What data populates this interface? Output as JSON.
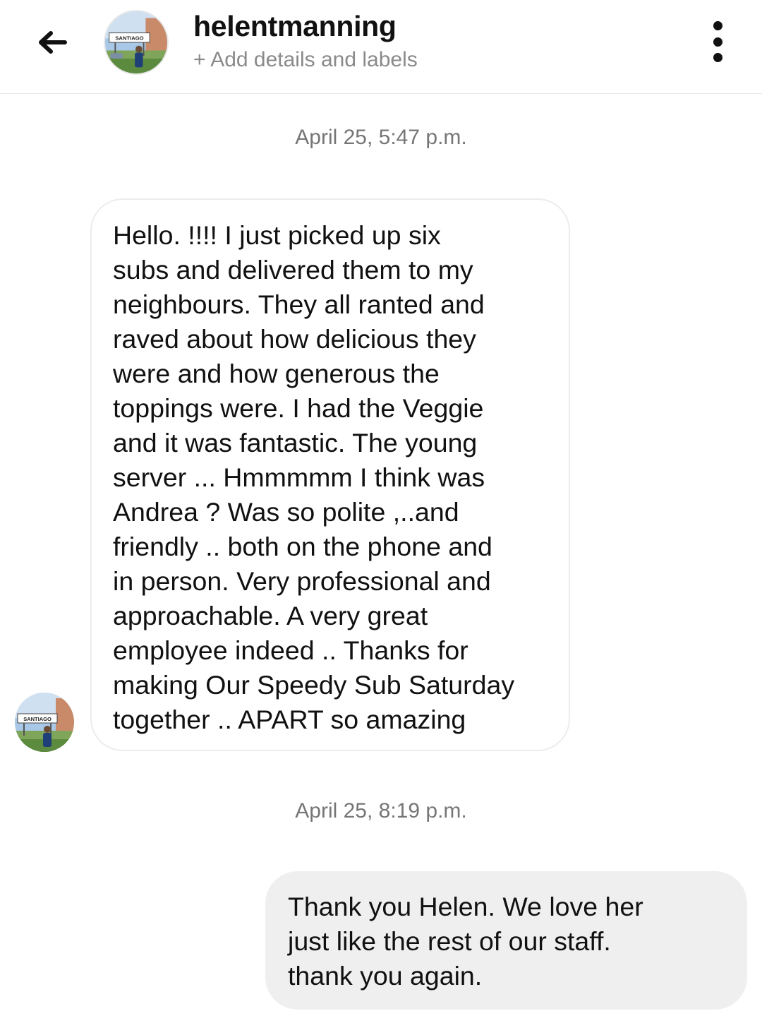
{
  "header": {
    "back_icon": "arrow-left-icon",
    "username": "helentmanning",
    "add_details": "+ Add details and labels",
    "more_icon": "vertical-dots-icon",
    "avatar_sign_text": "SANTIAGO"
  },
  "messages": [
    {
      "timestamp": "April 25, 5:47 p.m.",
      "direction": "incoming",
      "text": "Hello. !!!!  I just picked up six\nsubs and delivered them to my\nneighbours.  They all ranted and\nraved about how delicious they\nwere and how generous the\ntoppings were.  I had the Veggie\nand it was fantastic. The young\nserver ... Hmmmmm I think was\nAndrea ?  Was so polite ,..and\nfriendly .. both on the phone and\nin person.  Very professional and\napproachable. A very great\nemployee indeed ..  Thanks for\nmaking Our Speedy Sub Saturday\ntogether ..   APART so  amazing"
    },
    {
      "timestamp": "April 25, 8:19 p.m.",
      "direction": "outgoing",
      "text": "Thank you Helen. We love her\njust like the rest of our staff.\nthank you again."
    }
  ],
  "colors": {
    "outgoing_bubble": "#efefef",
    "incoming_border": "#ececec",
    "timestamp": "#767676",
    "subtitle": "#8a8a8a"
  }
}
